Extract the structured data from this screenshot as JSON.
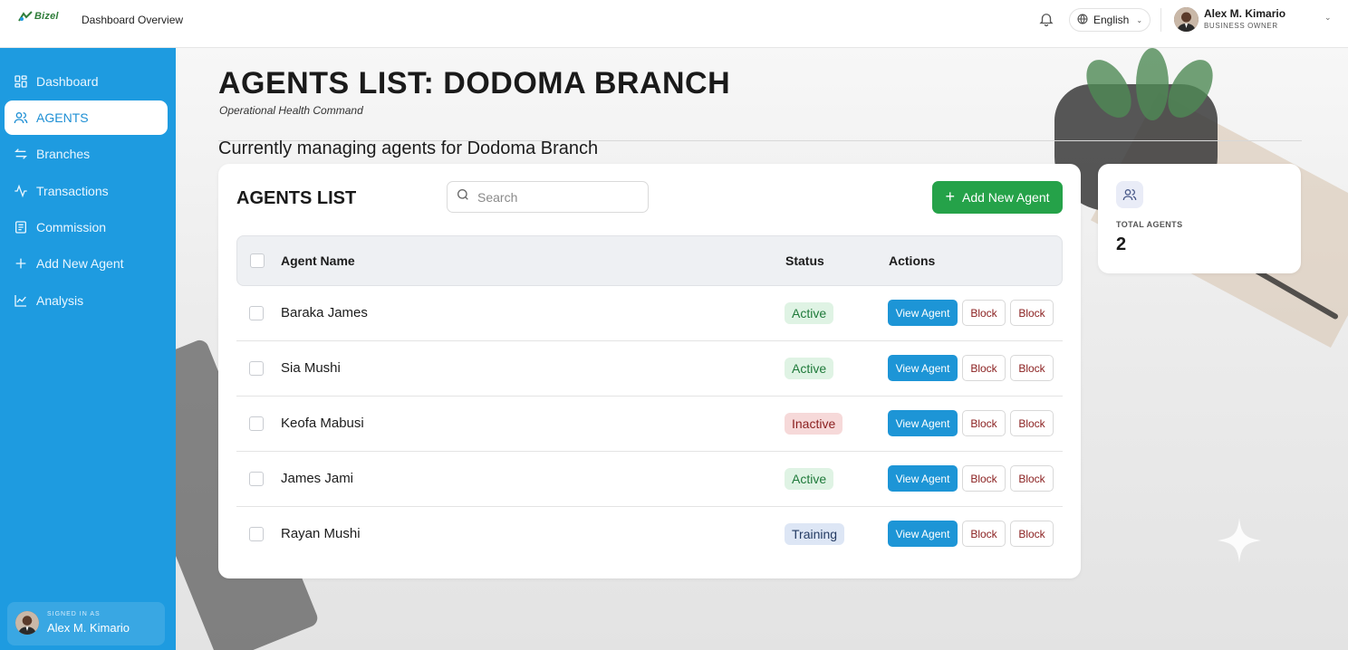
{
  "app": {
    "logo_text": "Bizel",
    "top_title": "Dashboard Overview"
  },
  "header": {
    "language": "English",
    "user_name": "Alex M. Kimario",
    "user_role": "BUSINESS OWNER"
  },
  "sidebar": {
    "items": [
      {
        "label": "Dashboard",
        "icon": "grid-icon"
      },
      {
        "label": "AGENTS",
        "icon": "users-icon",
        "active": true
      },
      {
        "label": "Branches",
        "icon": "arrows-icon"
      },
      {
        "label": "Transactions",
        "icon": "activity-icon"
      },
      {
        "label": "Commission",
        "icon": "receipt-icon"
      },
      {
        "label": "Add New Agent",
        "icon": "plus-icon"
      },
      {
        "label": "Analysis",
        "icon": "chart-line-icon"
      }
    ],
    "signed_in_label": "SIGNED IN AS",
    "signed_in_name": "Alex M. Kimario"
  },
  "page": {
    "title": "AGENTS LIST: DODOMA BRANCH",
    "subtitle": "Operational Health Command",
    "description": "Currently managing agents for Dodoma Branch"
  },
  "agents_card": {
    "title": "AGENTS LIST",
    "search_placeholder": "Search",
    "add_button": "Add New Agent",
    "columns": [
      "Agent Name",
      "Status",
      "Actions"
    ],
    "rows": [
      {
        "name": "Baraka James",
        "status": "Active",
        "status_kind": "active",
        "view": "View Agent",
        "block1": "Block",
        "block2": "Block"
      },
      {
        "name": "Sia Mushi",
        "status": "Active",
        "status_kind": "active",
        "view": "View Agent",
        "block1": "Block",
        "block2": "Block"
      },
      {
        "name": "Keofa Mabusi",
        "status": "Inactive",
        "status_kind": "inactive",
        "view": "View Agent",
        "block1": "Block",
        "block2": "Block"
      },
      {
        "name": "James Jami",
        "status": "Active",
        "status_kind": "active",
        "view": "View Agent",
        "block1": "Block",
        "block2": "Block"
      },
      {
        "name": "Rayan Mushi",
        "status": "Training",
        "status_kind": "training",
        "view": "View Agent",
        "block1": "Block",
        "block2": "Block"
      }
    ]
  },
  "stats": {
    "label": "TOTAL AGENTS",
    "value": "2"
  },
  "colors": {
    "sidebar": "#1e9be0",
    "primary_button": "#1d95d6",
    "add_button": "#25a249",
    "active_badge": "#dff3e4",
    "inactive_badge": "#f6d9d9",
    "training_badge": "#dde6f5"
  }
}
